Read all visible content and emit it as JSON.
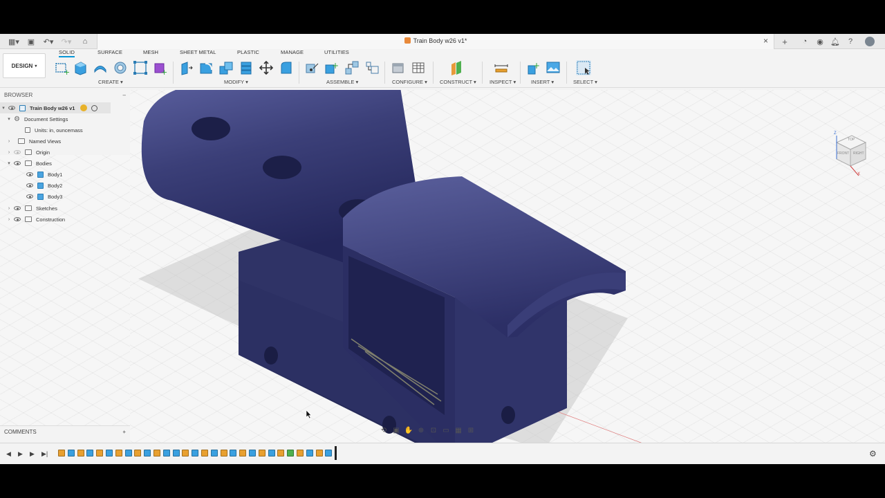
{
  "titlebar": {
    "document_title": "Train Body w26 v1*"
  },
  "toolbar": {
    "design_label": "DESIGN",
    "workspace_tabs": [
      "SOLID",
      "SURFACE",
      "MESH",
      "SHEET METAL",
      "PLASTIC",
      "MANAGE",
      "UTILITIES"
    ],
    "groups": {
      "create": "CREATE",
      "modify": "MODIFY",
      "assemble": "ASSEMBLE",
      "configure": "CONFIGURE",
      "construct": "CONSTRUCT",
      "inspect": "INSPECT",
      "insert": "INSERT",
      "select": "SELECT"
    }
  },
  "browser": {
    "header": "BROWSER",
    "root": "Train Body w26 v1",
    "document_settings": "Document Settings",
    "units": "Units: in, ouncemass",
    "named_views": "Named Views",
    "origin": "Origin",
    "bodies": "Bodies",
    "body_items": [
      "Body1",
      "Body2",
      "Body3"
    ],
    "sketches": "Sketches",
    "construction": "Construction"
  },
  "comments": {
    "label": "COMMENTS"
  },
  "viewcube": {
    "top": "TOP",
    "front": "FRONT",
    "right": "RIGHT",
    "axis_z": "Z",
    "axis_x": "X"
  },
  "colors": {
    "model": "#3b3f78",
    "accent": "#0696d7",
    "body_icon": "#4aa4e0"
  }
}
